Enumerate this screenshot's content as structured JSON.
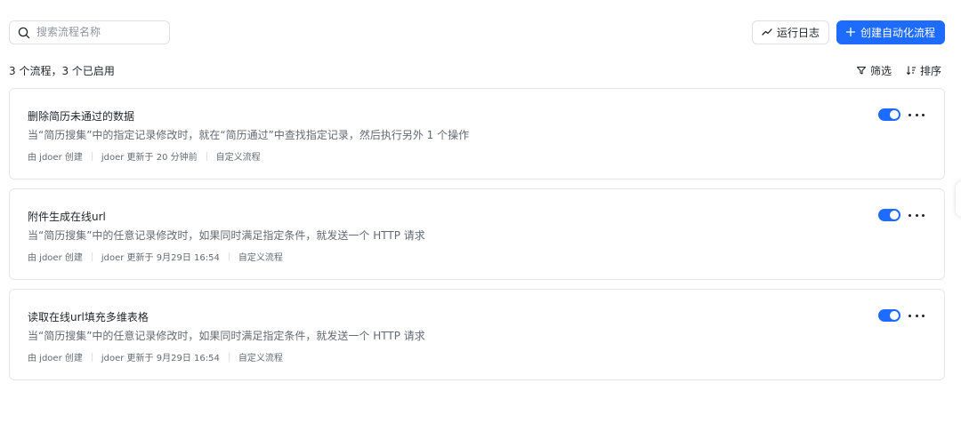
{
  "search": {
    "placeholder": "搜索流程名称"
  },
  "toolbar": {
    "log_label": "运行日志",
    "create_label": "创建自动化流程"
  },
  "summary": "3 个流程，3 个已启用",
  "tools": {
    "filter_label": "筛选",
    "sort_label": "排序"
  },
  "flows": [
    {
      "title": "删除简历未通过的数据",
      "description": "当“简历搜集”中的指定记录修改时，就在“简历通过”中查找指定记录，然后执行另外 1 个操作",
      "creator": "由 jdoer 创建",
      "updated": "jdoer 更新于 20 分钟前",
      "type": "自定义流程",
      "enabled": true
    },
    {
      "title": "附件生成在线url",
      "description": "当“简历搜集”中的任意记录修改时，如果同时满足指定条件，就发送一个 HTTP 请求",
      "creator": "由 jdoer 创建",
      "updated": "jdoer 更新于 9月29日 16:54",
      "type": "自定义流程",
      "enabled": true
    },
    {
      "title": "读取在线url填充多维表格",
      "description": "当“简历搜集”中的任意记录修改时，如果同时满足指定条件，就发送一个 HTTP 请求",
      "creator": "由 jdoer 创建",
      "updated": "jdoer 更新于 9月29日 16:54",
      "type": "自定义流程",
      "enabled": true
    }
  ],
  "colors": {
    "accent": "#1e6bff",
    "border": "#e5e6eb",
    "muted_text": "#646a73"
  },
  "icons": {
    "search": "search-icon",
    "log": "trend-line-icon",
    "create": "plus-icon",
    "filter": "filter-icon",
    "sort": "sort-icon",
    "more": "more-horizontal-icon"
  }
}
